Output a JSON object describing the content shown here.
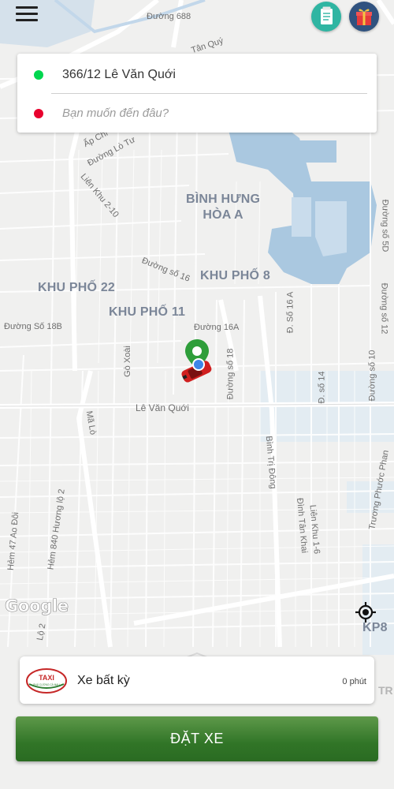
{
  "address_card": {
    "origin": "366/12 Lê Văn Quới",
    "destination_placeholder": "Bạn muốn đến đâu?",
    "origin_dot_color": "#00d64f",
    "destination_dot_color": "#e8002d"
  },
  "header": {
    "menu_icon": "hamburger-icon",
    "notes_icon": "notepad-icon",
    "gift_icon": "gift-icon"
  },
  "map": {
    "areas": [
      "BÌNH HƯNG\nHÒA A",
      "KHU PHỐ 8",
      "KHU PHỐ 22",
      "KHU PHỐ 11",
      "KP8"
    ],
    "streets": [
      "Đường 688",
      "Tân Quý",
      "Ấp Chi",
      "Đường Lò Tư",
      "Liên Khu 2-10",
      "Đường số 16",
      "Đường 16A",
      "Đường Số 18B",
      "Gò Xoài",
      "Đường số 18",
      "Lê Văn Quới",
      "Mã Lò",
      "Bình Trị Đông",
      "Liên Khu 1-6",
      "Đình Tân Khai",
      "Hẻm 47 Ao Đôi",
      "Hẻm 840 Hương lộ 2",
      "Đ. Số 16 A",
      "Đ. số 14",
      "Đường số 10",
      "Trương Phước Phan",
      "Đường số 5D",
      "Đường số 12",
      "Lộ 2",
      "TR"
    ],
    "google_logo": "Google",
    "locate_icon": "my-location-icon"
  },
  "vehicle": {
    "name": "Xe bất kỳ",
    "eta": "0 phút",
    "logo_text": "TAXI",
    "logo_sub": "PHÚ CƯỜNG CÀ MAU"
  },
  "actions": {
    "book_label": "ĐẶT XE",
    "book_color": "#317527"
  }
}
